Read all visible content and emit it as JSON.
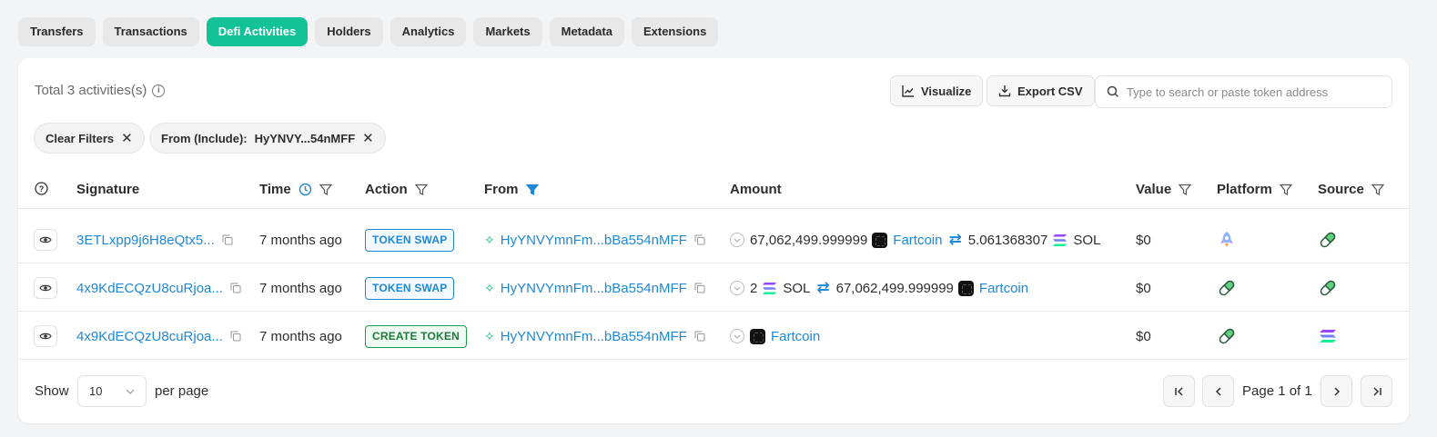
{
  "tabs": [
    {
      "label": "Transfers",
      "active": false
    },
    {
      "label": "Transactions",
      "active": false
    },
    {
      "label": "Defi Activities",
      "active": true
    },
    {
      "label": "Holders",
      "active": false
    },
    {
      "label": "Analytics",
      "active": false
    },
    {
      "label": "Markets",
      "active": false
    },
    {
      "label": "Metadata",
      "active": false
    },
    {
      "label": "Extensions",
      "active": false
    }
  ],
  "toolbar": {
    "total_text": "Total 3 activities(s)",
    "visualize_label": "Visualize",
    "export_label": "Export CSV",
    "search_placeholder": "Type to search or paste token address"
  },
  "filters": {
    "clear_label": "Clear Filters",
    "from_label": "From (Include):",
    "from_value": "HyYNVY...54nMFF"
  },
  "columns": {
    "signature": "Signature",
    "time": "Time",
    "action": "Action",
    "from": "From",
    "amount": "Amount",
    "value": "Value",
    "platform": "Platform",
    "source": "Source"
  },
  "rows": [
    {
      "signature": "3ETLxpp9j6H8eQtx5...",
      "time": "7 months ago",
      "action": "TOKEN SWAP",
      "from": "HyYNVYmnFm...bBa554nMFF",
      "amount_in": "67,062,499.999999",
      "token_in": "Fartcoin",
      "amount_out": "5.061368307",
      "token_out": "SOL",
      "value": "$0",
      "platform_icon": "pump-rocket-icon",
      "source_icon": "pill-icon"
    },
    {
      "signature": "4x9KdECQzU8cuRjoa...",
      "time": "7 months ago",
      "action": "TOKEN SWAP",
      "from": "HyYNVYmnFm...bBa554nMFF",
      "amount_in": "2",
      "token_in": "SOL",
      "amount_out": "67,062,499.999999",
      "token_out": "Fartcoin",
      "value": "$0",
      "platform_icon": "pill-icon",
      "source_icon": "pill-icon"
    },
    {
      "signature": "4x9KdECQzU8cuRjoa...",
      "time": "7 months ago",
      "action": "CREATE TOKEN",
      "from": "HyYNVYmnFm...bBa554nMFF",
      "token": "Fartcoin",
      "value": "$0",
      "platform_icon": "pill-icon",
      "source_icon": "solana-icon"
    }
  ],
  "pagination": {
    "show_label": "Show",
    "per_page_value": "10",
    "per_page_label": "per page",
    "page_text": "Page 1 of 1"
  },
  "colors": {
    "accent": "#13c296",
    "link": "#1e88d6",
    "swap_badge": "#1e88d6",
    "create_badge": "#1f9b4d"
  }
}
